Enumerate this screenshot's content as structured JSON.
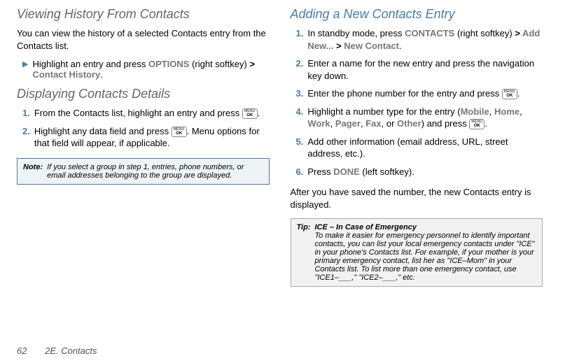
{
  "left": {
    "heading1": "Viewing History From Contacts",
    "para1": "You can view the history of a selected Contacts entry from the Contacts list.",
    "bullet_pre": "Highlight an entry and press ",
    "options": "OPTIONS",
    "bullet_mid": " (right softkey) ",
    "gt1": ">",
    "contact_history": " Contact History",
    "bullet_end": ".",
    "heading2": "Displaying Contacts Details",
    "step1_pre": "From the Contacts list, highlight an entry and press ",
    "step1_end": ".",
    "step2_pre": "Highlight any data field and press ",
    "step2_end": ". Menu options for that field will appear, if applicable.",
    "note_label": "Note:",
    "note_text": "If you select a group in step 1, entries, phone numbers, or email addresses belonging to the group are displayed."
  },
  "right": {
    "heading1": "Adding a New Contacts Entry",
    "step1_pre": "In standby mode, press ",
    "contacts": "CONTACTS",
    "step1_mid": " (right softkey) ",
    "gt1": ">",
    "addnew": " Add New... ",
    "gt2": ">",
    "newcontact": " New Contact",
    "step1_end": ".",
    "step2": "Enter a name for the new entry and press the navigation key down.",
    "step3_pre": "Enter the phone number for the entry and press ",
    "step3_end": ".",
    "step4_pre": "Highlight a number type for the entry (",
    "mobile": "Mobile",
    "c1": ", ",
    "home": "Home",
    "c2": ", ",
    "work": "Work",
    "c3": ", ",
    "pager": "Pager",
    "c4": ", ",
    "fax": "Fax",
    "c5": ", or ",
    "other": "Other",
    "step4_mid": ") and press ",
    "step4_end": ".",
    "step5": "Add other information (email address, URL, street address, etc.).",
    "step6_pre": "Press ",
    "done": "DONE",
    "step6_end": " (left softkey).",
    "after": "After you have saved the number, the new Contacts entry is displayed.",
    "tip_label": "Tip:",
    "tip_title": "ICE – In Case of Emergency",
    "tip_text": "To make it easier for emergency personnel to identify important contacts, you can list your local emergency contacts under \"ICE\" in your phone's Contacts list. For example, if your mother is your primary emergency contact, list her as \"ICE–Mom\" in your Contacts list. To list more than one emergency contact, use \"ICE1–___,\" \"ICE2–___,\" etc."
  },
  "footer": {
    "page": "62",
    "section": "2E. Contacts"
  },
  "ok": {
    "menu": "MENU",
    "ok": "OK"
  }
}
